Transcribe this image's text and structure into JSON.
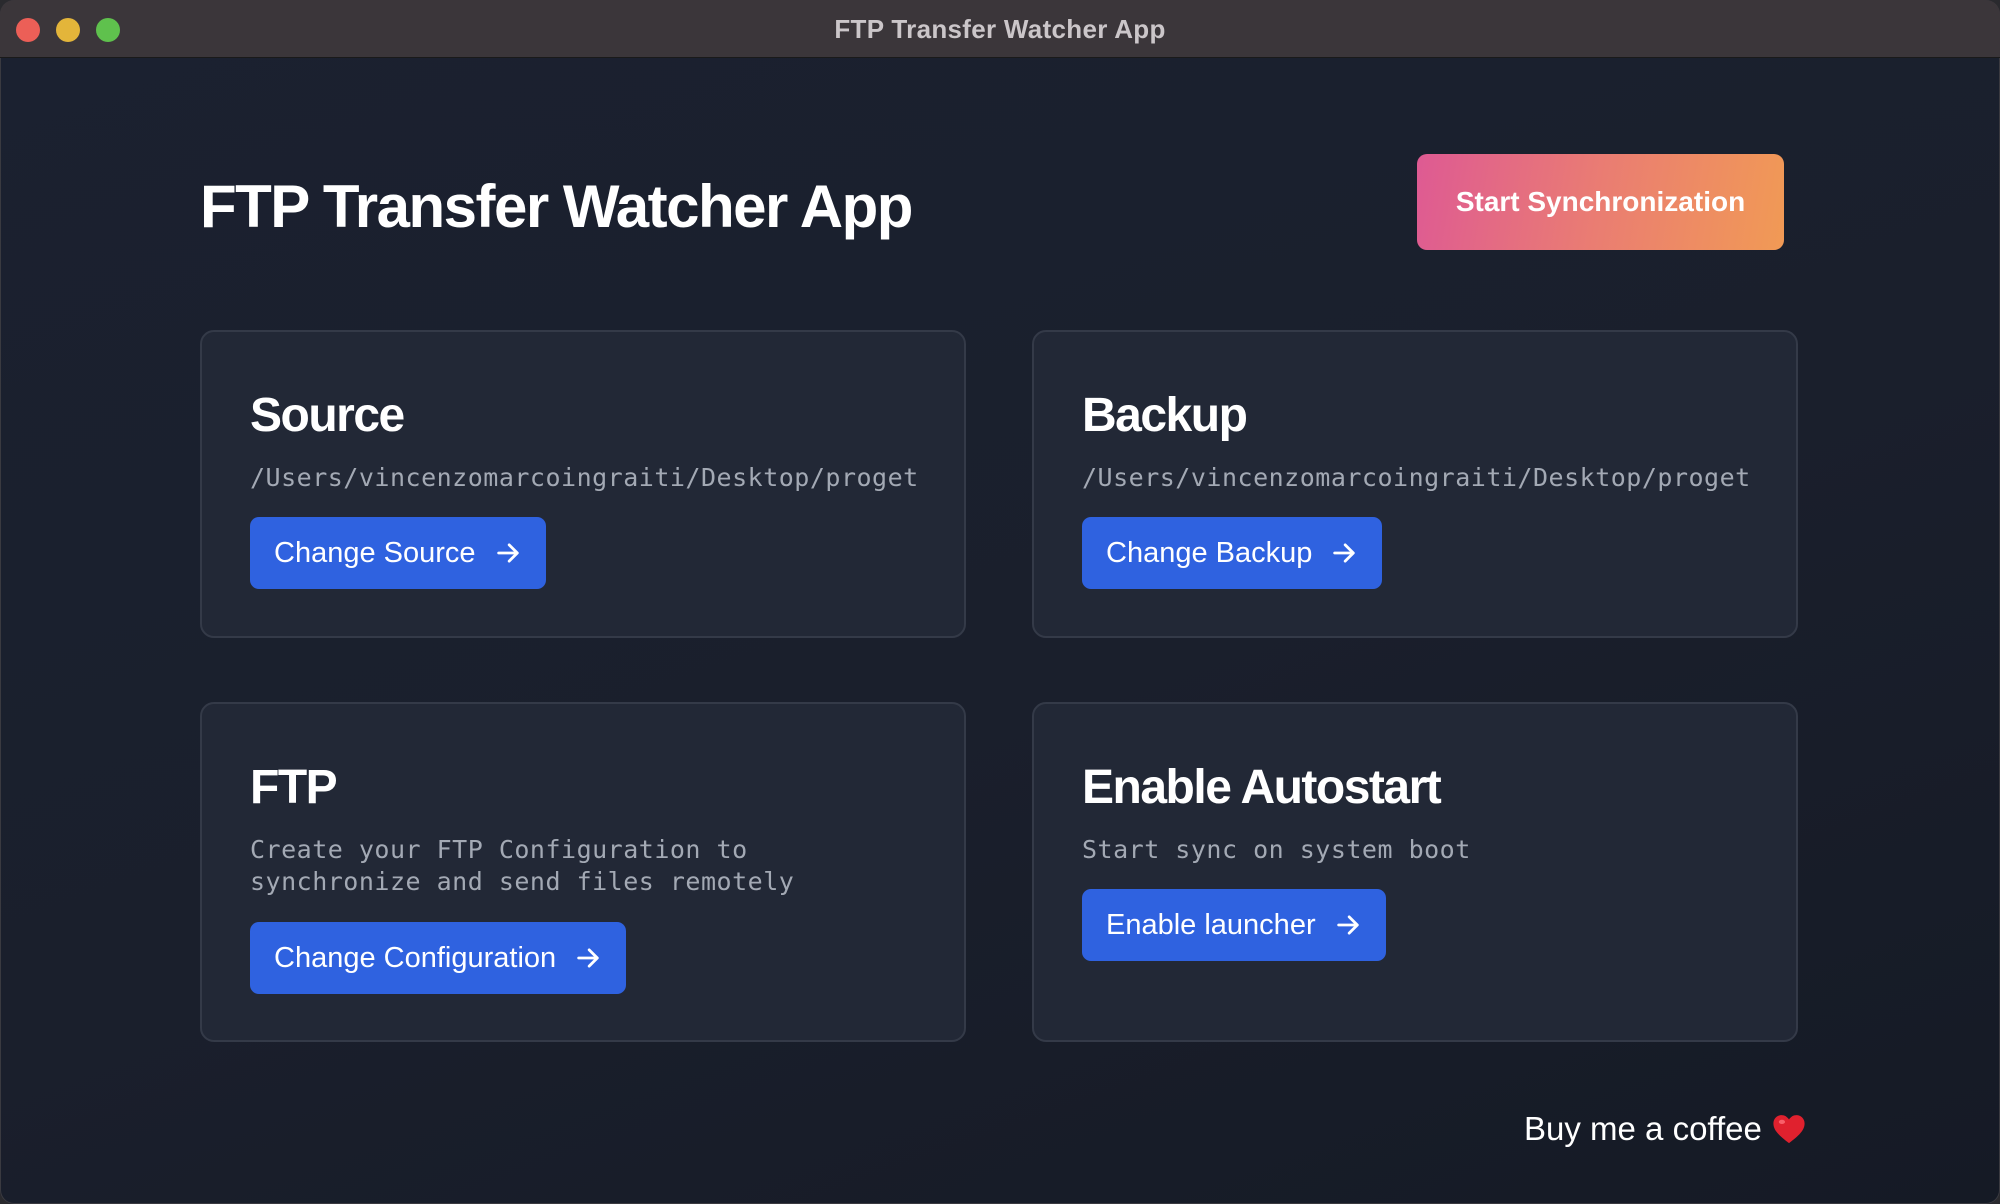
{
  "window": {
    "title": "FTP Transfer Watcher App"
  },
  "header": {
    "title": "FTP Transfer Watcher App",
    "sync_button": "Start Synchronization"
  },
  "cards": {
    "source": {
      "title": "Source",
      "path": "/Users/vincenzomarcoingraiti/Desktop/progetti/",
      "button": "Change Source"
    },
    "backup": {
      "title": "Backup",
      "path": "/Users/vincenzomarcoingraiti/Desktop/progetti/",
      "button": "Change Backup"
    },
    "ftp": {
      "title": "FTP",
      "description": "Create your FTP Configuration to synchronize and send files remotely",
      "button": "Change Configuration"
    },
    "autostart": {
      "title": "Enable Autostart",
      "description": "Start sync on system boot",
      "button": "Enable launcher"
    }
  },
  "footer": {
    "coffee_link": "Buy me a coffee"
  },
  "icons": {
    "arrow": "arrow-right-icon",
    "heart": "heart-icon"
  },
  "colors": {
    "accent": "#2f62e0",
    "sync_gradient_start": "#de5a93",
    "sync_gradient_end": "#f19a55",
    "background": "#1a1f2c",
    "card": "#222836"
  }
}
